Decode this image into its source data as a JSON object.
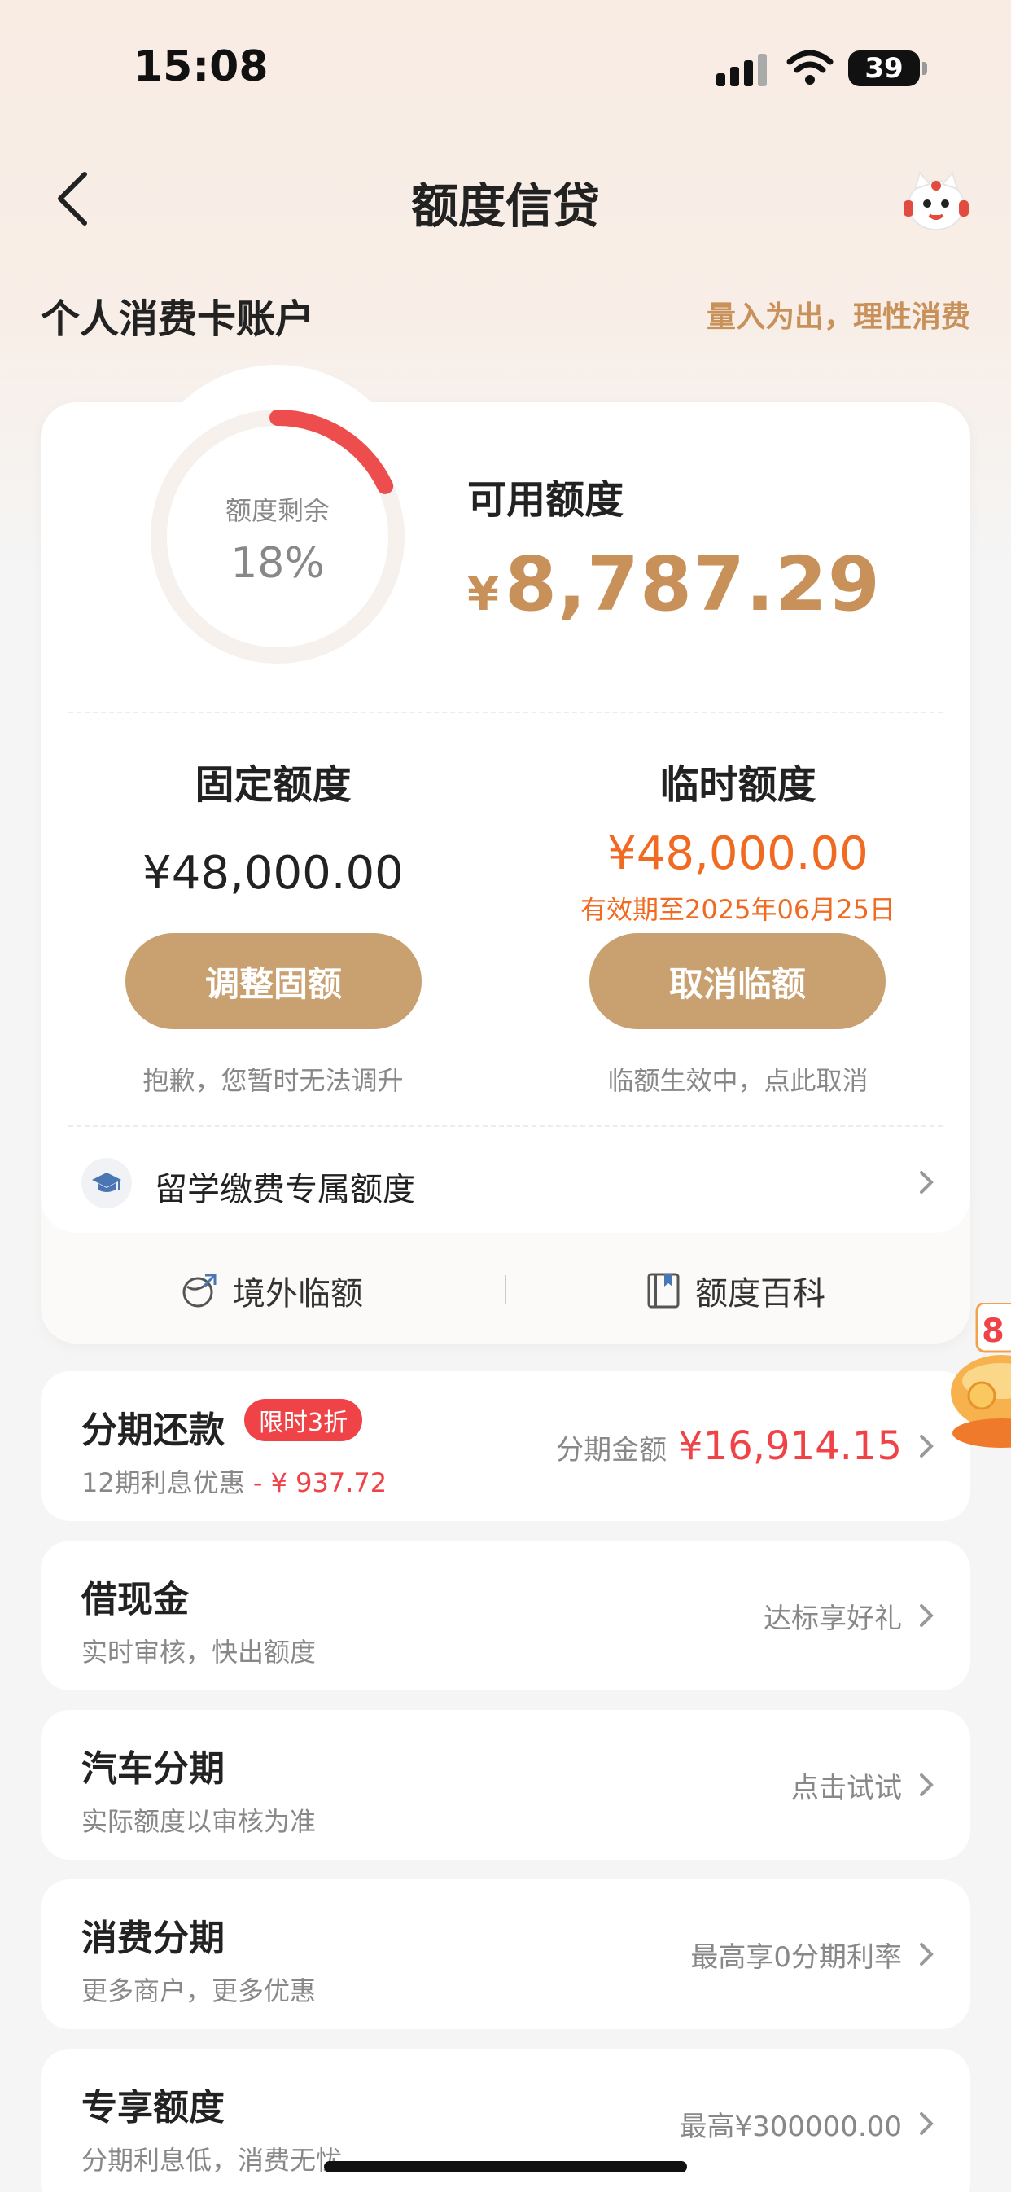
{
  "status_bar": {
    "time": "15:08",
    "battery": "39"
  },
  "nav": {
    "title": "额度信贷"
  },
  "account": {
    "title": "个人消费卡账户",
    "slogan": "量入为出，理性消费"
  },
  "credit_card": {
    "ring_label": "额度剩余",
    "ring_percent": "18%",
    "ring_fraction": 0.18,
    "available_label": "可用额度",
    "available_currency": "¥",
    "available_amount": "8,787.29",
    "fixed": {
      "title": "固定额度",
      "amount": "¥48,000.00",
      "button": "调整固额",
      "hint": "抱歉，您暂时无法调升"
    },
    "temp": {
      "title": "临时额度",
      "amount": "¥48,000.00",
      "validity": "有效期至2025年06月25日",
      "button": "取消临额",
      "hint": "临额生效中，点此取消"
    },
    "study": "留学缴费专属额度",
    "footer": {
      "overseas": "境外临额",
      "encyclopedia": "额度百科"
    }
  },
  "services": [
    {
      "title": "分期还款",
      "badge": "限时3折",
      "subtitle_prefix": "12期利息优惠",
      "subtitle_discount": " - ¥ 937.72",
      "right_label": "分期金额",
      "right_amount": "¥16,914.15"
    },
    {
      "title": "借现金",
      "subtitle": "实时审核，快出额度",
      "right": "达标享好礼"
    },
    {
      "title": "汽车分期",
      "subtitle": "实际额度以审核为准",
      "right": "点击试试"
    },
    {
      "title": "消费分期",
      "subtitle": "更多商户，更多优惠",
      "right": "最高享0分期利率"
    },
    {
      "title": "专享额度",
      "subtitle": "分期利息低，消费无忧",
      "right": "最高¥300000.00"
    }
  ],
  "colors": {
    "gold": "#c9915a",
    "button": "#c9a070",
    "orange": "#f06a22",
    "red": "#f04348",
    "ring": "#ee4d4d"
  }
}
